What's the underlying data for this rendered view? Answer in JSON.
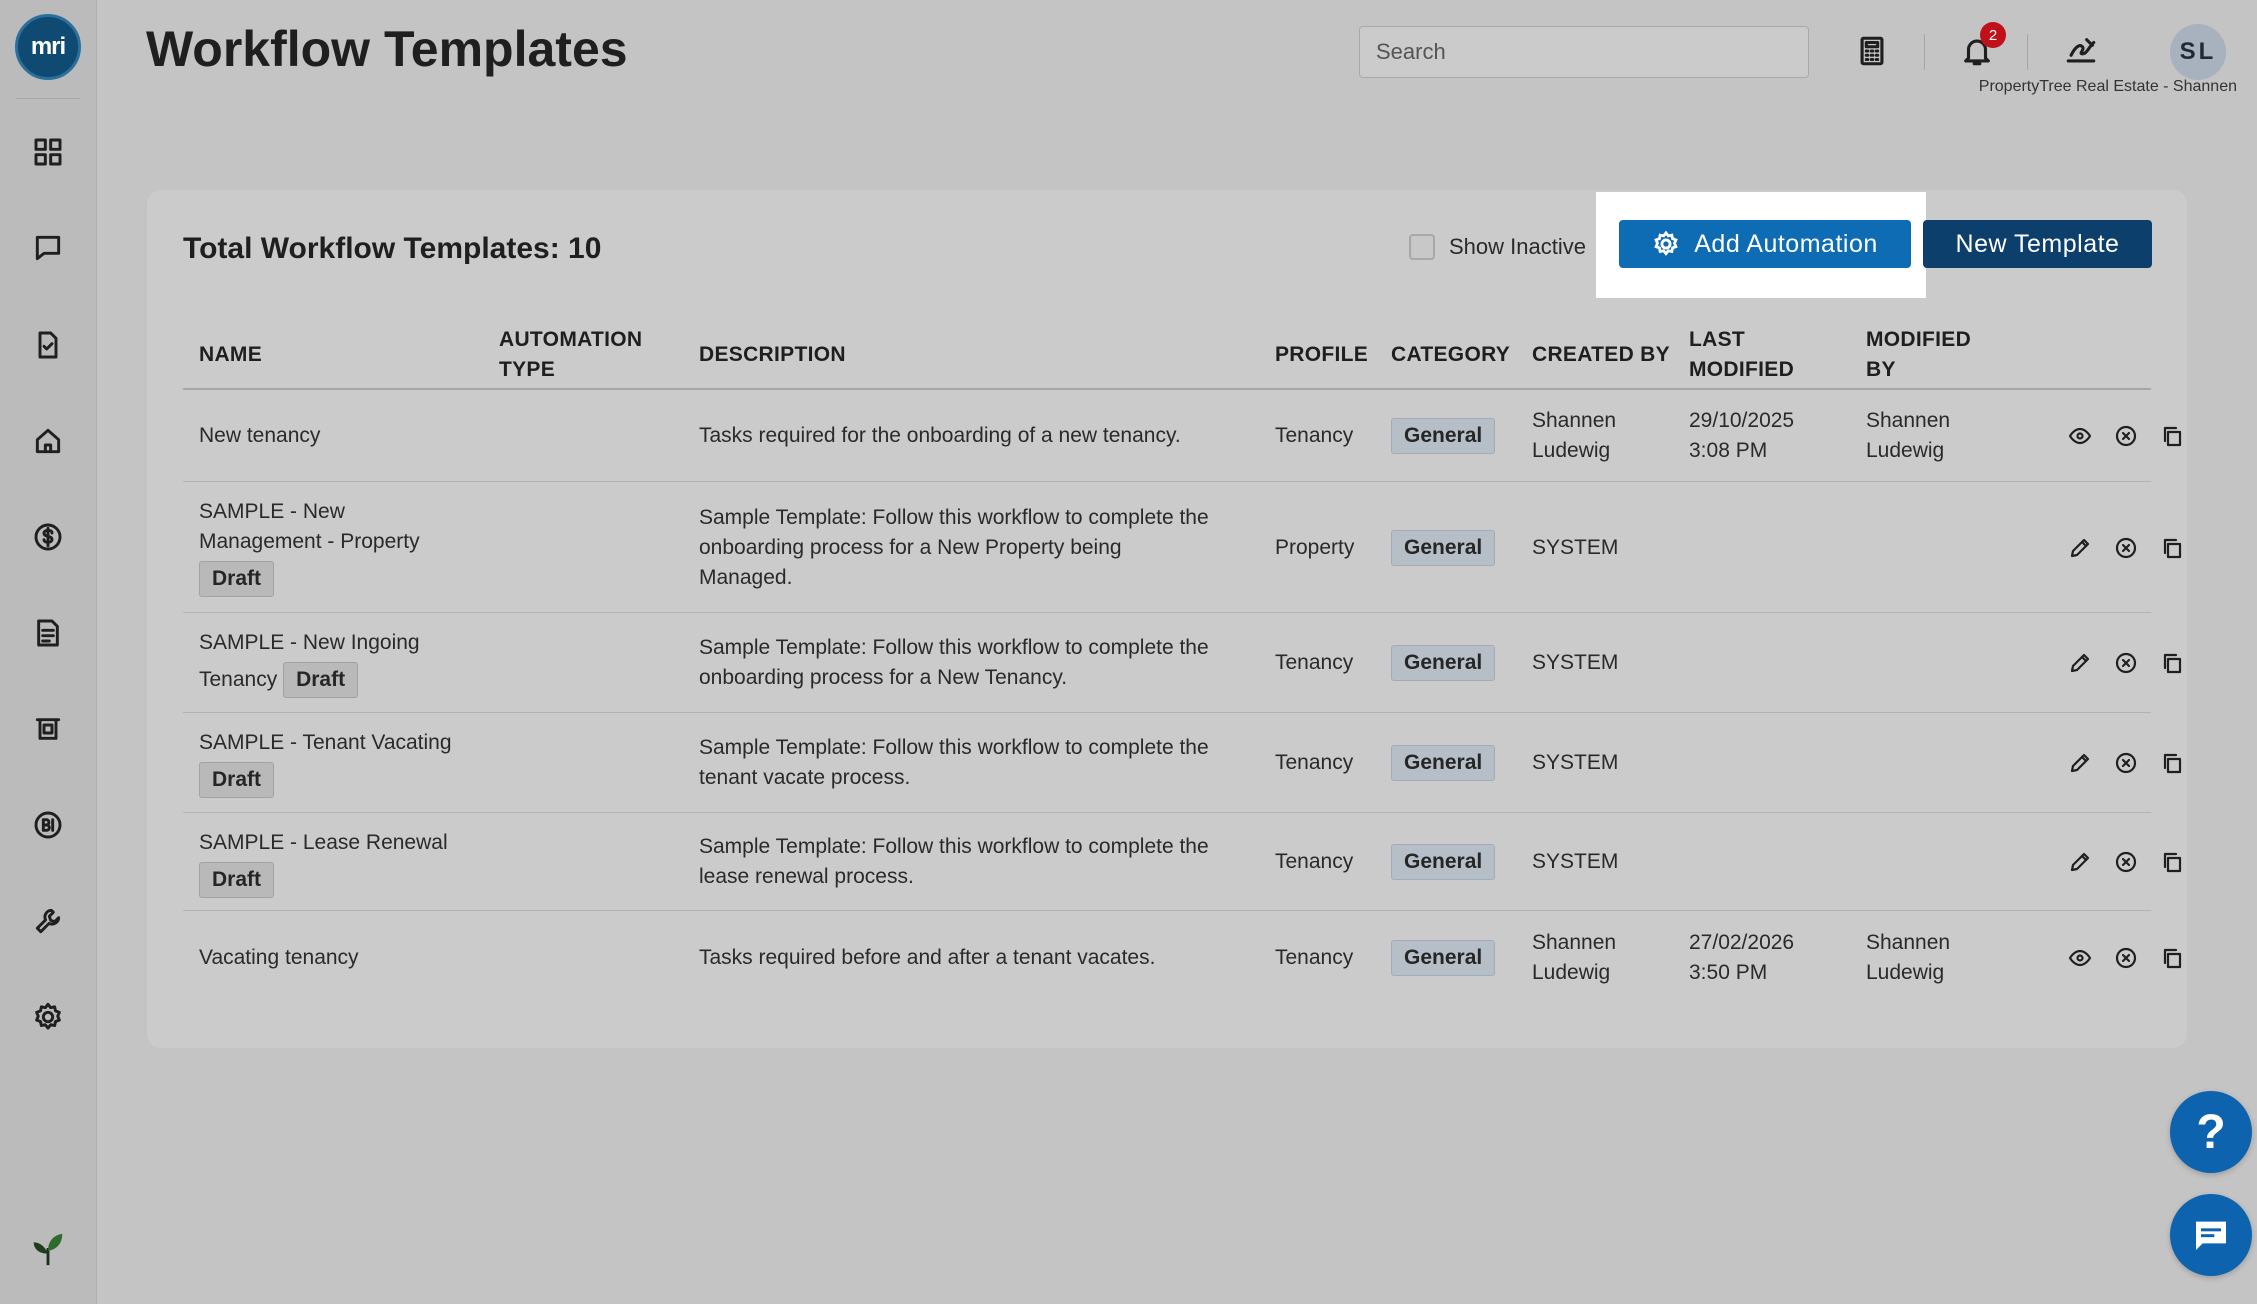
{
  "app": {
    "logo_text": "mri",
    "page_title": "Workflow Templates",
    "org_name": "PropertyTree Real Estate - Shannen",
    "avatar_initials": "SL",
    "notification_count": "2"
  },
  "search": {
    "placeholder": "Search"
  },
  "sidebar": {
    "items": [
      "dashboard-icon",
      "chat-icon",
      "task-check-icon",
      "home-icon",
      "dollar-icon",
      "document-icon",
      "frame-icon",
      "bi-icon",
      "wrench-icon",
      "settings-icon"
    ]
  },
  "card": {
    "title": "Total Workflow Templates: 10",
    "show_inactive_label": "Show Inactive",
    "add_automation_label": "Add Automation",
    "new_template_label": "New Template"
  },
  "columns": {
    "name": "NAME",
    "automation_type_1": "AUTOMATION",
    "automation_type_2": "TYPE",
    "description": "DESCRIPTION",
    "profile": "PROFILE",
    "category": "CATEGORY",
    "created_by": "CREATED BY",
    "last_modified_1": "LAST",
    "last_modified_2": "MODIFIED",
    "modified_by_1": "MODIFIED",
    "modified_by_2": "BY"
  },
  "rows": [
    {
      "name1": "New tenancy",
      "name2": "",
      "draft": "",
      "desc1": "Tasks required for the onboarding of a new tenancy.",
      "desc2": "",
      "desc3": "",
      "profile": "Tenancy",
      "category": "General",
      "created1": "Shannen",
      "created2": "Ludewig",
      "modified1": "29/10/2025",
      "modified2": "3:08 PM",
      "modby1": "Shannen",
      "modby2": "Ludewig"
    },
    {
      "name1": "SAMPLE - New",
      "name2": "Management - Property",
      "draft": "Draft",
      "desc1": "Sample Template: Follow this workflow to complete the",
      "desc2": "onboarding process for a New Property being",
      "desc3": "Managed.",
      "profile": "Property",
      "category": "General",
      "created1": "SYSTEM",
      "created2": "",
      "modified1": "",
      "modified2": "",
      "modby1": "",
      "modby2": ""
    },
    {
      "name1": "SAMPLE - New Ingoing",
      "name2": "Tenancy",
      "draft": "Draft",
      "desc1": "Sample Template: Follow this workflow to complete the",
      "desc2": "onboarding process for a New Tenancy.",
      "desc3": "",
      "profile": "Tenancy",
      "category": "General",
      "created1": "SYSTEM",
      "created2": "",
      "modified1": "",
      "modified2": "",
      "modby1": "",
      "modby2": ""
    },
    {
      "name1": "SAMPLE - Tenant Vacating",
      "name2": "",
      "draft": "Draft",
      "desc1": "Sample Template: Follow this workflow to complete the",
      "desc2": "tenant vacate process.",
      "desc3": "",
      "profile": "Tenancy",
      "category": "General",
      "created1": "SYSTEM",
      "created2": "",
      "modified1": "",
      "modified2": "",
      "modby1": "",
      "modby2": ""
    },
    {
      "name1": "SAMPLE - Lease Renewal",
      "name2": "",
      "draft": "Draft",
      "desc1": "Sample Template: Follow this workflow to complete the",
      "desc2": "lease renewal process.",
      "desc3": "",
      "profile": "Tenancy",
      "category": "General",
      "created1": "SYSTEM",
      "created2": "",
      "modified1": "",
      "modified2": "",
      "modby1": "",
      "modby2": ""
    },
    {
      "name1": "Vacating tenancy",
      "name2": "",
      "draft": "",
      "desc1": "Tasks required before and after a tenant vacates.",
      "desc2": "",
      "desc3": "",
      "profile": "Tenancy",
      "category": "General",
      "created1": "Shannen",
      "created2": "Ludewig",
      "modified1": "27/02/2026",
      "modified2": "3:50 PM",
      "modby1": "Shannen",
      "modby2": "Ludewig"
    }
  ],
  "floating": {
    "help_label": "?"
  }
}
